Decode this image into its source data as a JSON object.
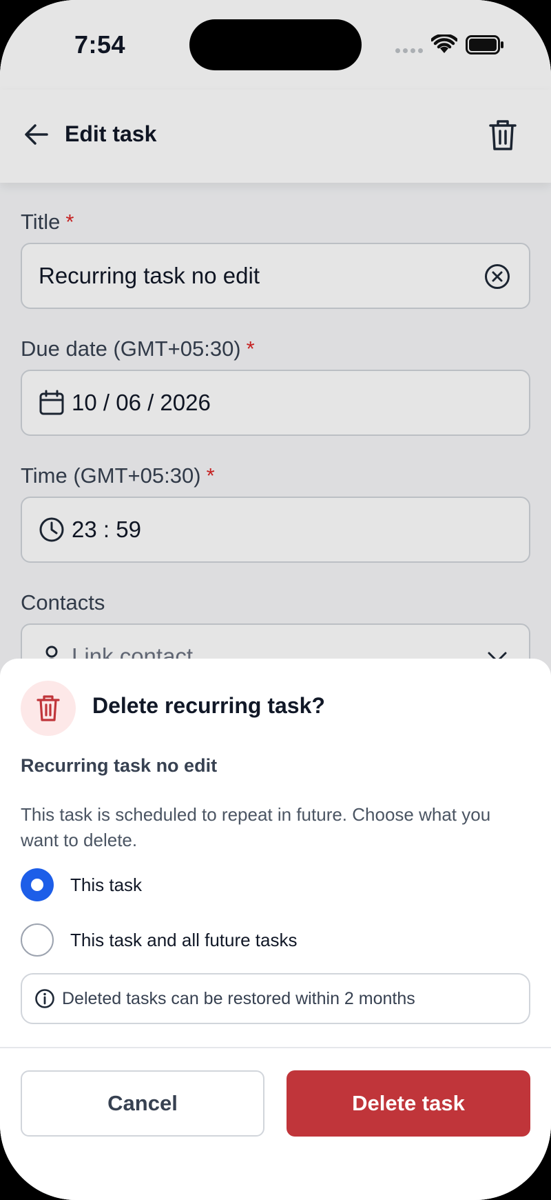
{
  "status_bar": {
    "time": "7:54"
  },
  "header": {
    "title": "Edit task",
    "back_icon": "arrow-left-icon",
    "delete_icon": "trash-icon"
  },
  "form": {
    "title": {
      "label": "Title",
      "required_mark": "*",
      "value": "Recurring task no edit"
    },
    "due_date": {
      "label": "Due date (GMT+05:30)",
      "required_mark": "*",
      "value": "10 / 06 / 2026"
    },
    "time": {
      "label": "Time (GMT+05:30)",
      "required_mark": "*",
      "value": "23 : 59"
    },
    "contacts": {
      "label": "Contacts",
      "placeholder": "Link contact"
    }
  },
  "dialog": {
    "title": "Delete recurring task?",
    "task_name": "Recurring task no edit",
    "description": "This task is scheduled to repeat in future. Choose what you want to delete.",
    "options": [
      {
        "label": "This task",
        "selected": true
      },
      {
        "label": "This task and all future tasks",
        "selected": false
      }
    ],
    "info": "Deleted tasks can be restored within 2 months",
    "cancel_label": "Cancel",
    "delete_label": "Delete task"
  },
  "colors": {
    "accent": "#1d5ee8",
    "danger": "#c0353a",
    "danger_bg": "#fde8e8",
    "required": "#dc2626"
  }
}
